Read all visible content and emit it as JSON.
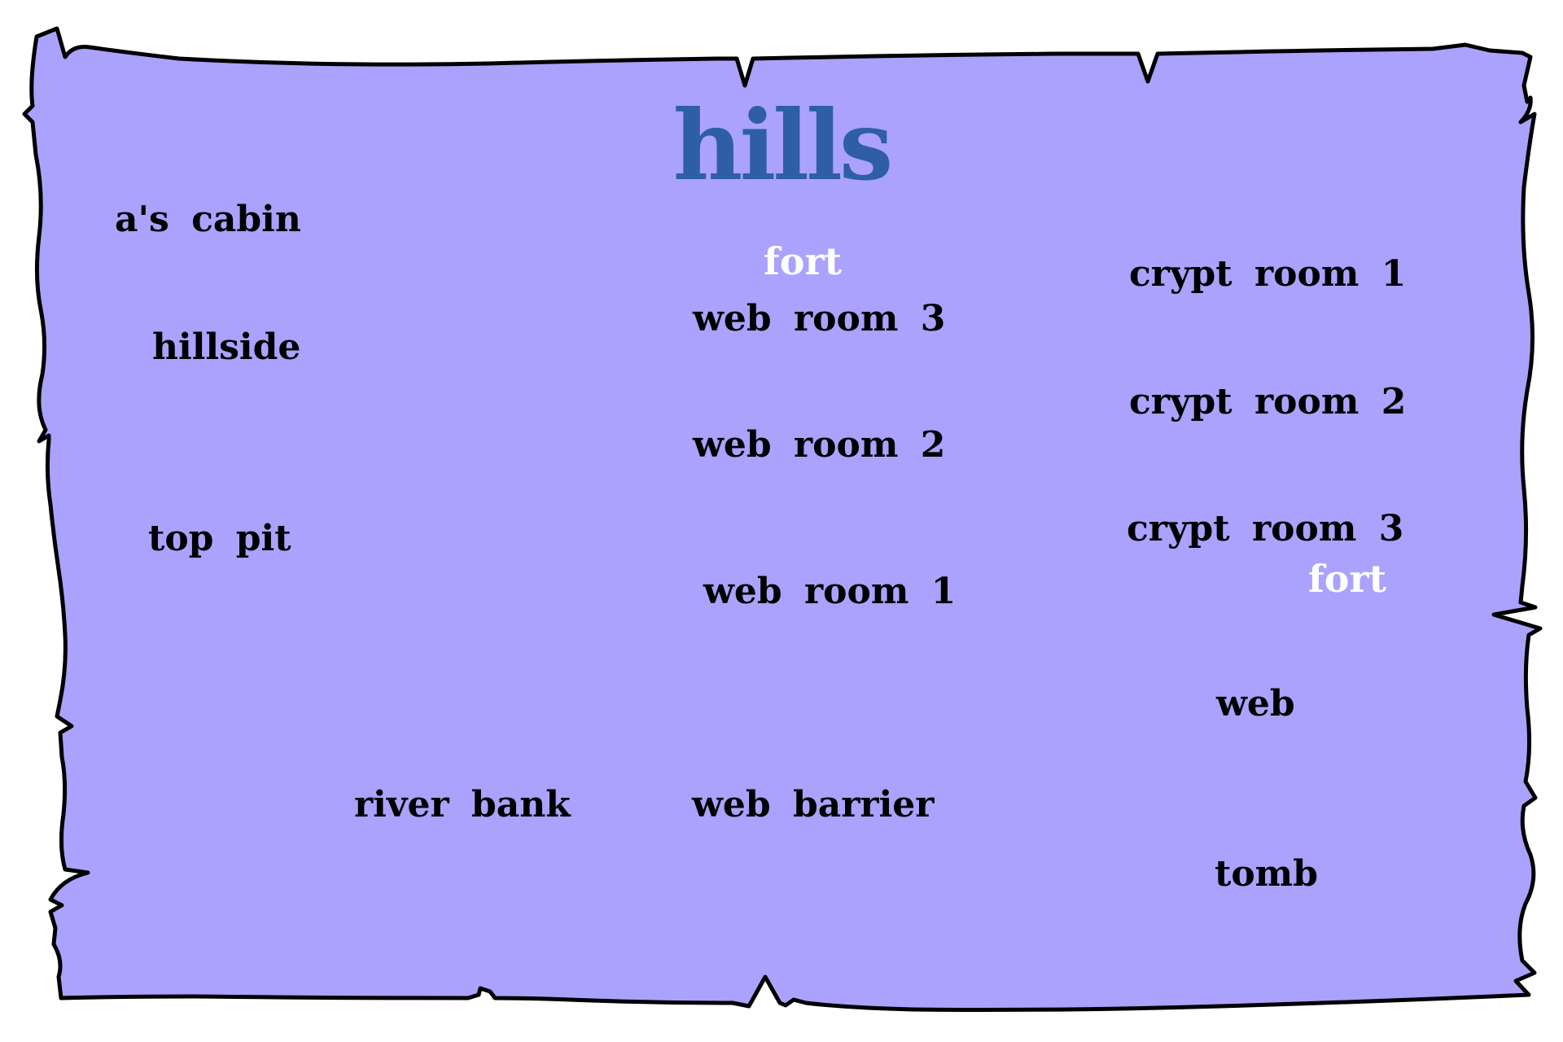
{
  "map": {
    "title": "hills",
    "colors": {
      "background": "#ffffff",
      "parchment": "#aaa2fd",
      "outline": "#000000",
      "title": "#2e5fa6",
      "label": "#000000",
      "fort_label": "#ffffff"
    },
    "locations": {
      "as_cabin": "a's cabin",
      "hillside": "hillside",
      "top_pit": "top pit",
      "river_bank": "river bank",
      "fort_top": "fort",
      "web_room_3": "web room 3",
      "web_room_2": "web room 2",
      "web_room_1": "web room 1",
      "web_barrier": "web barrier",
      "crypt_room_1": "crypt room 1",
      "crypt_room_2": "crypt room 2",
      "crypt_room_3": "crypt room 3",
      "fort_right": "fort",
      "web": "web",
      "tomb": "tomb"
    }
  }
}
